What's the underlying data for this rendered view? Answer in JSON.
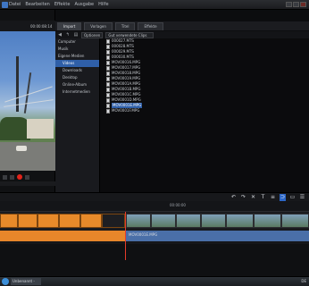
{
  "menu": [
    "Datei",
    "Bearbeiten",
    "Effekte",
    "Ausgabe",
    "Hilfe"
  ],
  "preview": {
    "timecode": "00:00:08:14"
  },
  "tabs": [
    {
      "label": "Import",
      "active": true
    },
    {
      "label": "Vorlagen",
      "active": false
    },
    {
      "label": "Titel",
      "active": false
    },
    {
      "label": "Effekte",
      "active": false
    }
  ],
  "toolbar": {
    "options_label": "Optionen",
    "filter_label": "Gut verwendete Clips"
  },
  "sidebar": [
    {
      "label": "Computer",
      "selected": false,
      "indent": false
    },
    {
      "label": "Musik",
      "selected": false,
      "indent": false
    },
    {
      "label": "Eigene Medien",
      "selected": false,
      "indent": false
    },
    {
      "label": "Videos",
      "selected": true,
      "indent": true
    },
    {
      "label": "Downloads",
      "selected": false,
      "indent": true
    },
    {
      "label": "Desktop",
      "selected": false,
      "indent": true
    },
    {
      "label": "Online-Album",
      "selected": false,
      "indent": true
    },
    {
      "label": "Internetmedien",
      "selected": false,
      "indent": true
    }
  ],
  "files": [
    {
      "name": "000027.MTS",
      "selected": false
    },
    {
      "name": "000028.MTS",
      "selected": false
    },
    {
      "name": "000029.MTS",
      "selected": false
    },
    {
      "name": "000030.MTS",
      "selected": false
    },
    {
      "name": "MOV00016.MPG",
      "selected": false
    },
    {
      "name": "MOV00017.MPG",
      "selected": false
    },
    {
      "name": "MOV00018.MPG",
      "selected": false
    },
    {
      "name": "MOV00019.MPG",
      "selected": false
    },
    {
      "name": "MOV0001A.MPG",
      "selected": false
    },
    {
      "name": "MOV0001B.MPG",
      "selected": false
    },
    {
      "name": "MOV0001C.MPG",
      "selected": false
    },
    {
      "name": "MOV0001D.MPG",
      "selected": false
    },
    {
      "name": "MOV0001E.MPG",
      "selected": true
    },
    {
      "name": "MOV0001F.MPG",
      "selected": false
    }
  ],
  "timeline": {
    "ruler_timecode": "00:00:00",
    "audio_clip_label": "MOV0001E.MPG"
  },
  "taskbar": {
    "task_label": "Unbenannt - Vid...",
    "tray": "DE"
  },
  "colors": {
    "accent": "#2f5fa8",
    "clip_orange": "#e7862a",
    "record_red": "#e2231a"
  }
}
